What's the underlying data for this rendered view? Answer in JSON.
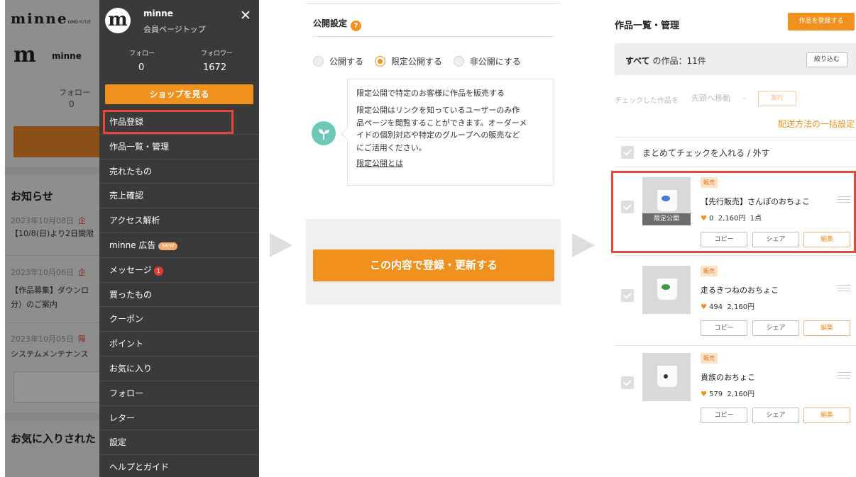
{
  "bg_page": {
    "logo": "minne",
    "logo_sub": "GMOペパボ",
    "profile_mark": "m",
    "profile_name": "minne",
    "follow_label": "フォロー",
    "follow_value": "0",
    "orange_btn_fragment": "シ",
    "news_heading": "お知らせ",
    "news": [
      {
        "date": "2023年10月08日",
        "cat": "企",
        "text": "【10/8(日)より2日間限"
      },
      {
        "date": "2023年10月06日",
        "cat": "企",
        "text": "【作品募集】ダウンロ",
        "text2": "分）のご案内"
      },
      {
        "date": "2023年10月05日",
        "cat": "障",
        "text": "システムメンテナンス"
      }
    ],
    "fav_heading": "お気に入りされた"
  },
  "drawer": {
    "avatar_letter": "m",
    "name": "minne",
    "subtitle": "会員ページトップ",
    "close_glyph": "✕",
    "follow_label": "フォロー",
    "follow_value": "0",
    "follower_label": "フォロワー",
    "follower_value": "1672",
    "shop_button": "ショップを見る",
    "menu": [
      {
        "label": "作品登録"
      },
      {
        "label": "作品一覧・管理"
      },
      {
        "label": "売れたもの"
      },
      {
        "label": "売上確認"
      },
      {
        "label": "アクセス解析"
      },
      {
        "label": "minne 広告",
        "badge_new": "NEW"
      },
      {
        "label": "メッセージ",
        "badge_count": "1"
      },
      {
        "label": "買ったもの"
      },
      {
        "label": "クーポン"
      },
      {
        "label": "ポイント"
      },
      {
        "label": "お気に入り"
      },
      {
        "label": "フォロー"
      },
      {
        "label": "レター"
      },
      {
        "label": "設定"
      },
      {
        "label": "ヘルプとガイド"
      }
    ]
  },
  "publish": {
    "title": "公開設定",
    "help_glyph": "?",
    "options": [
      {
        "label": "公開する",
        "selected": false
      },
      {
        "label": "限定公開する",
        "selected": true
      },
      {
        "label": "非公開にする",
        "selected": false
      }
    ],
    "callout_title": "限定公開で特定のお客様に作品を販売する",
    "callout_lines": [
      "限定公開はリンクを知っているユーザーのみ作",
      "品ページを閲覧することができます。オーダーメ",
      "イドの個別対応や特定のグループへの販売など",
      "にご活用ください。"
    ],
    "callout_link": "限定公開とは",
    "submit": "この内容で登録・更新する"
  },
  "items": {
    "title": "作品一覧・管理",
    "add_button": "作品を登録する",
    "all_label": "すべて",
    "count_text": "の作品：11件",
    "filter_button": "絞り込む",
    "checked_label": "チェックした作品を",
    "move_select": "先頭へ移動",
    "execute": "実行",
    "shipping_bulk": "配送方法の一括設定",
    "bulk_check": "まとめてチェックを入れる / 外す",
    "list": [
      {
        "tag": "販売",
        "name": "【先行販売】さんぽのおちょこ",
        "likes": "0",
        "price": "2,160円",
        "stock": "1点",
        "limited": "限定公開",
        "copy": "コピー",
        "share": "シェア",
        "edit": "編集"
      },
      {
        "tag": "販売",
        "name": "走るきつねのおちょこ",
        "likes": "494",
        "price": "2,160円",
        "stock": "",
        "limited": "",
        "copy": "コピー",
        "share": "シェア",
        "edit": "編集"
      },
      {
        "tag": "販売",
        "name": "貴族のおちょこ",
        "likes": "579",
        "price": "2,160円",
        "stock": "",
        "limited": "",
        "copy": "コピー",
        "share": "シェア",
        "edit": "編集"
      }
    ]
  },
  "colors": {
    "accent": "#f0901d",
    "highlight": "#e8463b",
    "drawer_bg": "#3a3a3a"
  }
}
